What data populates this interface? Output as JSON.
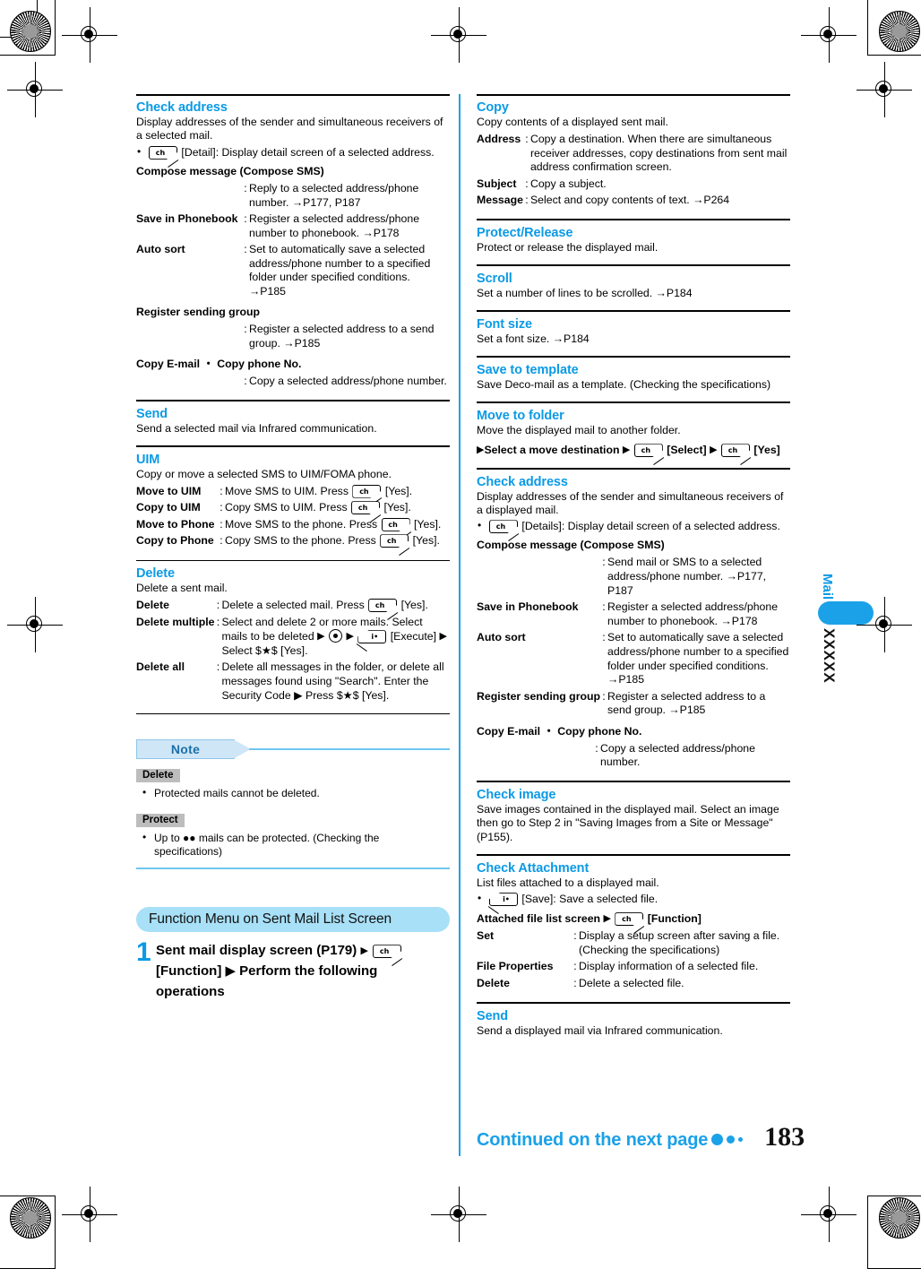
{
  "page": {
    "number": "183",
    "continued_label": "Continued on the next page",
    "side_tab": {
      "chapter": "Mail",
      "code": "XXXXX"
    }
  },
  "left_column": {
    "sections": [
      {
        "title": "Check address",
        "desc": "Display addresses of the sender and simultaneous receivers of a selected mail.",
        "bullet": "[Detail]: Display detail screen of a selected address.",
        "sub": "Compose message (Compose SMS)",
        "rows": [
          {
            "term": "",
            "def": "Reply to a selected address/phone number. →P177, P187"
          },
          {
            "term": "Save in Phonebook",
            "def": "Register a selected address/phone number to phonebook. →P178"
          },
          {
            "term": "Auto sort",
            "def": "Set to automatically save a selected address/phone number to a specified folder under specified conditions. →P185"
          }
        ],
        "sub2": "Register sending group",
        "rows2": [
          {
            "term": "",
            "def": "Register a selected address to a send group. →P185"
          }
        ],
        "sub3": "Copy E-mail ・ Copy phone No.",
        "rows3": [
          {
            "term": "",
            "def": "Copy a selected address/phone number."
          }
        ]
      },
      {
        "title": "Send",
        "desc": "Send a selected mail via Infrared communication."
      },
      {
        "title": "UIM",
        "desc": "Copy or move a selected SMS to UIM/FOMA phone.",
        "rows": [
          {
            "term": "Move to UIM",
            "def_a": "Move SMS to UIM. Press",
            "def_b": "[Yes]."
          },
          {
            "term": "Copy to UIM",
            "def_a": "Copy SMS to UIM. Press",
            "def_b": "[Yes]."
          },
          {
            "term": "Move to Phone",
            "def_a": "Move SMS to the phone. Press",
            "def_b": "[Yes]."
          },
          {
            "term": "Copy to Phone",
            "def_a": "Copy SMS to the phone. Press",
            "def_b": "[Yes]."
          }
        ]
      },
      {
        "title": "Delete",
        "desc": "Delete a sent mail.",
        "rows": [
          {
            "term": "Delete",
            "def_a": "Delete a selected mail. Press",
            "def_b": "[Yes]."
          },
          {
            "term": "Delete multiple",
            "def_a": "Select and delete 2 or more mails. Select mails to be deleted",
            "def_b": "[Execute]",
            "def_c": "Select $★$ [Yes]."
          },
          {
            "term": "Delete all",
            "def_a": "Delete all messages in the folder, or delete all messages found using \"Search\". Enter the Security Code ▶ Press $★$ [Yes]."
          }
        ]
      }
    ],
    "note": {
      "heading": "Note",
      "groups": [
        {
          "badge": "Delete",
          "items": [
            "Protected mails cannot be deleted."
          ]
        },
        {
          "badge": "Protect",
          "items": [
            "Up to ●● mails can be protected. (Checking the specifications)"
          ]
        }
      ]
    },
    "function_menu": {
      "banner": "Function Menu on Sent Mail List Screen",
      "step_number": "1",
      "step_text_a": "Sent mail display screen (P179)",
      "step_text_b": "[Function] ▶ Perform the following operations"
    }
  },
  "right_column": {
    "sections": [
      {
        "title": "Copy",
        "desc": "Copy contents of a displayed sent mail.",
        "rows": [
          {
            "term": "Address",
            "def": "Copy a destination. When there are simultaneous receiver addresses, copy destinations from sent mail address confirmation screen."
          },
          {
            "term": "Subject",
            "def": "Copy a subject."
          },
          {
            "term": "Message",
            "def": "Select and copy contents of text. →P264"
          }
        ]
      },
      {
        "title": "Protect/Release",
        "desc": "Protect or release the displayed mail."
      },
      {
        "title": "Scroll",
        "desc": "Set a number of lines to be scrolled. →P184"
      },
      {
        "title": "Font size",
        "desc": "Set a font size. →P184"
      },
      {
        "title": "Save to template",
        "desc": "Save Deco-mail as a template. (Checking the specifications)"
      },
      {
        "title": "Move to folder",
        "desc": "Move the displayed mail to another folder.",
        "oper_a": "Select a move destination",
        "oper_b": "[Select]",
        "oper_c": "[Yes]"
      },
      {
        "title": "Check address",
        "desc": "Display addresses of the sender and simultaneous receivers of a displayed mail.",
        "bullet": "[Details]: Display detail screen of a selected address.",
        "sub": "Compose message (Compose SMS)",
        "rows": [
          {
            "term": "",
            "def": "Send mail or SMS to a selected address/phone number. →P177, P187"
          },
          {
            "term": "Save in Phonebook",
            "def": "Register a selected address/phone number to phonebook. →P178"
          },
          {
            "term": "Auto sort",
            "def": "Set to automatically save a selected address/phone number to a specified folder under specified conditions. →P185"
          },
          {
            "term": "Register sending group",
            "def": "Register a selected address to a send group. →P185"
          }
        ],
        "sub3": "Copy E-mail ・ Copy phone No.",
        "rows3": [
          {
            "term": "",
            "def": "Copy a selected address/phone number."
          }
        ]
      },
      {
        "title": "Check image",
        "desc": "Save images contained in the displayed mail. Select an image then go to Step 2 in \"Saving Images from a Site or Message\" (P155)."
      },
      {
        "title": "Check Attachment",
        "desc": "List files attached to a displayed mail.",
        "bullet": "[Save]: Save a selected file.",
        "oper_a": "Attached file list screen",
        "oper_b": "[Function]",
        "rows": [
          {
            "term": "Set",
            "def": "Display a setup screen after saving a file. (Checking the specifications)"
          },
          {
            "term": "File Properties",
            "def": "Display information of a selected file."
          },
          {
            "term": "Delete",
            "def": "Delete a selected file."
          }
        ]
      },
      {
        "title": "Send",
        "desc": "Send a displayed mail via Infrared communication."
      }
    ]
  }
}
